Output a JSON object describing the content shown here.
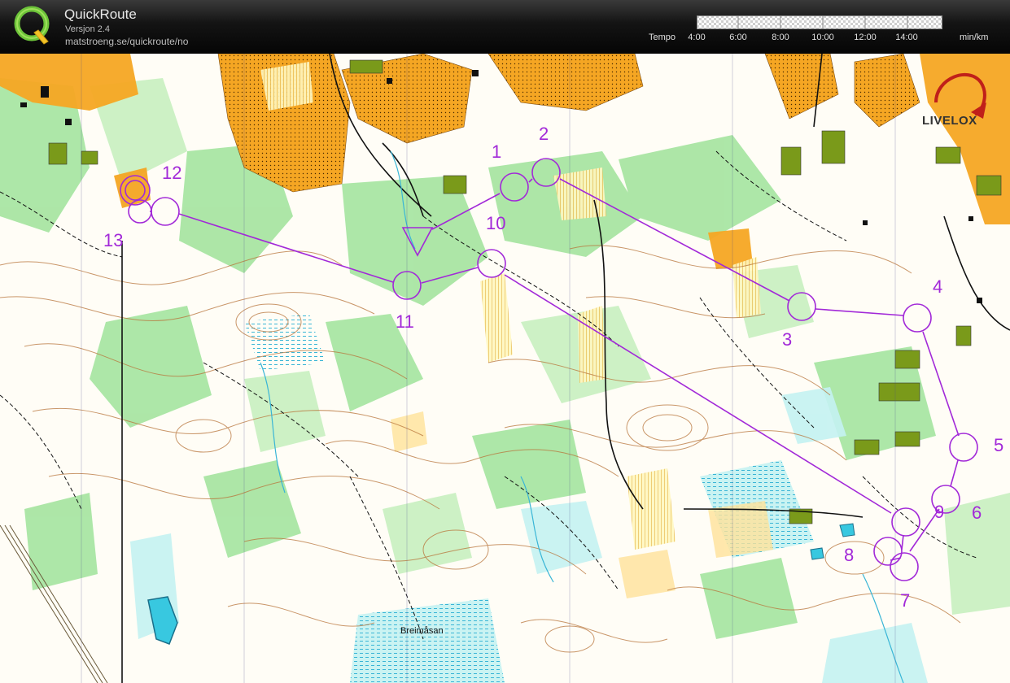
{
  "app": {
    "title": "QuickRoute",
    "version": "Versjon 2.4",
    "url": "matstroeng.se/quickroute/no",
    "logo_letter": "Q"
  },
  "pace": {
    "label": "Tempo",
    "ticks": [
      "4:00",
      "6:00",
      "8:00",
      "10:00",
      "12:00",
      "14:00"
    ],
    "unit": "min/km"
  },
  "map": {
    "place_name": "Breimåsan",
    "watermark": "LIVELOX",
    "course_color": "#a229d8",
    "controls": [
      {
        "id": "1",
        "label": "1"
      },
      {
        "id": "2",
        "label": "2"
      },
      {
        "id": "3",
        "label": "3"
      },
      {
        "id": "4",
        "label": "4"
      },
      {
        "id": "5",
        "label": "5"
      },
      {
        "id": "6",
        "label": "6"
      },
      {
        "id": "7",
        "label": "7"
      },
      {
        "id": "8",
        "label": "8"
      },
      {
        "id": "9",
        "label": "9"
      },
      {
        "id": "10",
        "label": "10"
      },
      {
        "id": "11",
        "label": "11"
      },
      {
        "id": "12",
        "label": "12"
      },
      {
        "id": "13",
        "label": "13"
      }
    ]
  },
  "colors": {
    "course": "#a229d8",
    "open_land": "#f5a623",
    "forest_green": "#8fdc8a",
    "water": "#b8f0f0",
    "contour": "#b8743a"
  }
}
